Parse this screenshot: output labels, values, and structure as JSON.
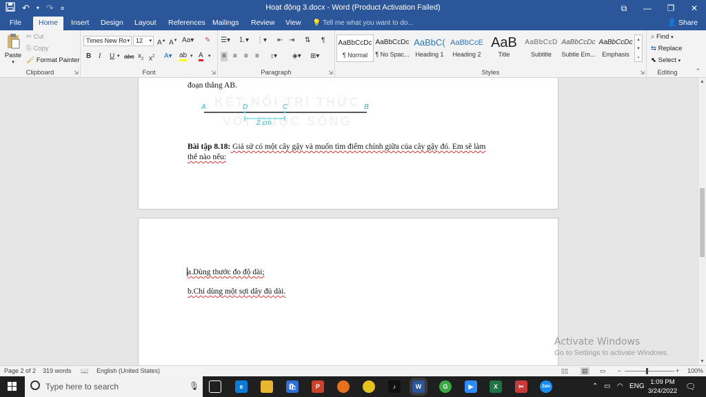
{
  "titlebar": {
    "title": "Hoạt động 3.docx - Word (Product Activation Failed)",
    "save_icon": "save-icon",
    "undo_icon": "undo-icon",
    "redo_icon": "redo-icon"
  },
  "tabs": [
    "File",
    "Home",
    "Insert",
    "Design",
    "Layout",
    "References",
    "Mailings",
    "Review",
    "View"
  ],
  "tell_me": "Tell me what you want to do...",
  "share": "Share",
  "ribbon": {
    "clipboard": {
      "paste": "Paste",
      "cut": "Cut",
      "copy": "Copy",
      "format_painter": "Format Painter",
      "label": "Clipboard"
    },
    "font": {
      "family": "Times New Ro",
      "size": "12",
      "label": "Font"
    },
    "paragraph": {
      "label": "Paragraph"
    },
    "styles": {
      "label": "Styles",
      "items": [
        {
          "sample": "AaBbCcDc",
          "name": "¶ Normal"
        },
        {
          "sample": "AaBbCcDc",
          "name": "¶ No Spac..."
        },
        {
          "sample": "AaBbC(",
          "name": "Heading 1"
        },
        {
          "sample": "AaBbCcE",
          "name": "Heading 2"
        },
        {
          "sample": "AaB",
          "name": "Title"
        },
        {
          "sample": "AaBbCcD",
          "name": "Subtitle"
        },
        {
          "sample": "AaBbCcDc",
          "name": "Subtle Em..."
        },
        {
          "sample": "AaBbCcDc",
          "name": "Emphasis"
        }
      ]
    },
    "editing": {
      "find": "Find",
      "replace": "Replace",
      "select": "Select",
      "label": "Editing"
    }
  },
  "document": {
    "top_line": "đoạn thẳng AB.",
    "diagram": {
      "points": [
        "A",
        "D",
        "C",
        "B"
      ],
      "measure": "2 cm"
    },
    "watermark_l1": "KẾT NỐI TRI THỨC",
    "watermark_l2": "VỚI CUỘC SỐNG",
    "exercise_title": "Bài tập 8.18:",
    "exercise_body": " Giả sử có một cây gậy và muốn tìm điểm chính giữa của cây gậy đó. Em sẽ làm",
    "exercise_line2": "thế nào nếu:",
    "item_a": "a.Dùng thước đo độ dài;",
    "item_b": "b.Chỉ dùng một sợi dây đủ dài."
  },
  "activate": {
    "line1": "Activate Windows",
    "line2": "Go to Settings to activate Windows."
  },
  "statusbar": {
    "page": "Page 2 of 2",
    "words": "319 words",
    "language": "English (United States)",
    "zoom": "100%"
  },
  "taskbar": {
    "search_placeholder": "Type here to search",
    "language": "ENG",
    "time": "1:09 PM",
    "date": "3/24/2022"
  }
}
